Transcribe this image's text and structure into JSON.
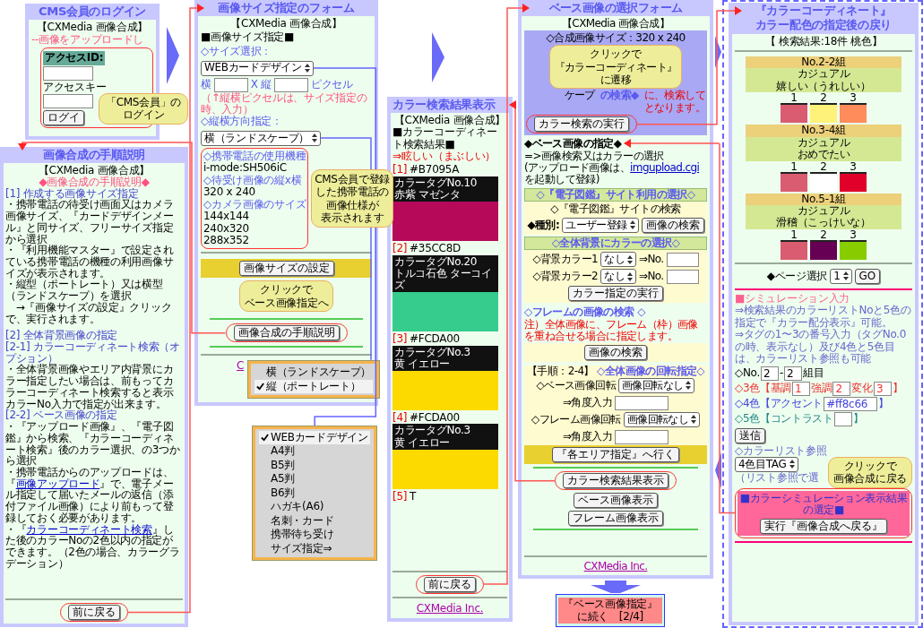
{
  "login_panel": {
    "title": "CMS会員のログイン",
    "header": "【CXMedia 画像合成】",
    "notice": "--画像をアップロードし",
    "id_label": "アクセスID:",
    "key_label": "アクセスキー",
    "login_button": "ログイ"
  },
  "login_callout": [
    "「CMS会員」の",
    "ログイン"
  ],
  "size_form": {
    "title": "画像サイズ指定のフォーム",
    "header": "【CXMedia 画像合成】",
    "section": "■画像サイズ指定■",
    "size_label": "◇サイズ選択：",
    "size_select": "WEBカードデザイン",
    "width_label": "横",
    "height_label": "X 縦",
    "pixel_unit": "ピクセル",
    "pixel_note": "（↑縦横ピクセルは、サイズ指定の時、入力）",
    "orientation_label": "◇縦横方向指定：",
    "orientation_select": "横（ランドスケープ）",
    "specs": [
      {
        "kind": "heading",
        "text": "◇携帯電話の使用機種"
      },
      {
        "kind": "value",
        "text": "i-mode:SH506iC"
      },
      {
        "kind": "heading",
        "text": "◇待受け画像の縦x横"
      },
      {
        "kind": "value",
        "text": "320 x 240"
      },
      {
        "kind": "heading",
        "text": "◇カメラ画像のサイズ"
      },
      {
        "kind": "value",
        "text": "144x144"
      },
      {
        "kind": "value",
        "text": "240x320"
      },
      {
        "kind": "value",
        "text": "288x352"
      }
    ],
    "set_button": "画像サイズの設定",
    "guide_button": "画像合成の手順説明",
    "footer_link": "C"
  },
  "spec_callout": [
    "CMS会員で登録",
    "した携帯電話の",
    "画像仕様が",
    "表示されます"
  ],
  "set_callout": [
    "クリックで",
    "ベース画像指定へ"
  ],
  "orientation_menu": [
    {
      "label": "横（ランドスケープ）",
      "selected": false
    },
    {
      "label": "縦（ポートレート）",
      "selected": true
    }
  ],
  "size_menu": [
    {
      "label": "WEBカードデザイン",
      "selected": true
    },
    {
      "label": "A4判",
      "selected": false
    },
    {
      "label": "B5判",
      "selected": false
    },
    {
      "label": "A5判",
      "selected": false
    },
    {
      "label": "B6判",
      "selected": false
    },
    {
      "label": "ハガキ(A6)",
      "selected": false
    },
    {
      "label": "名刺・カード",
      "selected": false
    },
    {
      "label": "携帯待ち受け",
      "selected": false
    },
    {
      "label": "サイズ指定⇒",
      "selected": false
    }
  ],
  "procedure": {
    "title": "画像合成の手順説明",
    "header": "【CXMedia 画像合成】",
    "subtitle": "◆画像合成の手順説明◆",
    "blocks": [
      {
        "kind": "heading",
        "parts": [
          {
            "kind": "plain",
            "text": "[1] 作成する画像サイズ指定"
          }
        ]
      },
      {
        "kind": "text",
        "parts": [
          {
            "kind": "plain",
            "text": "・携帯電話の待受け画面又はカメラ画像サイズ、『カードデザインメール』と同サイズ、フリーサイズ指定から選択"
          }
        ]
      },
      {
        "kind": "text",
        "parts": [
          {
            "kind": "plain",
            "text": "・『利用機能マスター』で設定されている携帯電話の機種の利用画像サイズが表示されます。"
          }
        ]
      },
      {
        "kind": "text",
        "parts": [
          {
            "kind": "plain",
            "text": "・縦型（ポートレート）又は横型（ランドスケープ）を選択"
          }
        ]
      },
      {
        "kind": "text",
        "parts": [
          {
            "kind": "plain",
            "text": "　→『画像サイズの設定』クリックで、実行されます。"
          }
        ]
      },
      {
        "kind": "gap"
      },
      {
        "kind": "heading",
        "parts": [
          {
            "kind": "plain",
            "text": "[2] 全体背景画像の指定"
          }
        ]
      },
      {
        "kind": "heading",
        "parts": [
          {
            "kind": "plain",
            "text": "[2-1] カラーコーディネート検索（オプション）"
          }
        ]
      },
      {
        "kind": "text",
        "parts": [
          {
            "kind": "plain",
            "text": "・全体背景画像やエリア内背景にカラー指定したい場合は、前もってカラーコーディネート検索すると表示カラーNo入力で指定が出来ます。"
          }
        ]
      },
      {
        "kind": "heading",
        "parts": [
          {
            "kind": "plain",
            "text": "[2-2] ベース画像の指定"
          }
        ]
      },
      {
        "kind": "text",
        "parts": [
          {
            "kind": "plain",
            "text": "・『アップロード画像』、『電子図鑑』から検索、『カラーコーディネート検索』後のカラー選択、の3つから選択"
          }
        ]
      },
      {
        "kind": "text",
        "parts": [
          {
            "kind": "plain",
            "text": "・携帯電話からのアップロードは、『"
          },
          {
            "kind": "link",
            "text": "画像アップロード"
          },
          {
            "kind": "plain",
            "text": "』で、電子メール指定して届いたメールの返信（添付ファイル画像）により前もって登録しておく必要があります。"
          }
        ]
      },
      {
        "kind": "text",
        "parts": [
          {
            "kind": "plain",
            "text": "・『"
          },
          {
            "kind": "link",
            "text": "カラーコーディネート検索"
          },
          {
            "kind": "plain",
            "text": "』した後のカラーNoの2色以内の指定ができます。（2色の場合、カラーグラデーション）"
          }
        ]
      }
    ],
    "back_button": "前に戻る"
  },
  "color_results": {
    "title": "カラー検索結果表示",
    "header": "【CXMedia 画像合成】",
    "subtitle": "■カラーコーディネート検索結果■",
    "mood": "⇒眩しい（まぶしい）",
    "swatches": [
      {
        "index": "[1]",
        "code": "#B7095A",
        "tag": "カラータグNo.10",
        "name": "赤紫 マゼンタ",
        "color": "#b7095a"
      },
      {
        "index": "[2]",
        "code": "#35CC8D",
        "tag": "カラータグNo.20",
        "name": "トルコ石色 ターコイズ",
        "color": "#35cc8d"
      },
      {
        "index": "[3]",
        "code": "#FCDA00",
        "tag": "カラータグNo.3",
        "name": "黄 イエロー",
        "color": "#fcda00"
      },
      {
        "index": "[4]",
        "code": "#FCDA00",
        "tag": "カラータグNo.3",
        "name": "黄 イエロー",
        "color": "#fcda00"
      }
    ],
    "last_index": "[5]",
    "last_code": "T",
    "back_button": "前に戻る",
    "footer_link": "CXMedia Inc."
  },
  "base_form": {
    "title": "ベース画像の選択フォーム",
    "header": "【CXMedia 画像合成】",
    "size_line": "◇合成画像サイズ：320 x 240",
    "fragments": [
      {
        "kind": "plain",
        "text": "ケープ"
      },
      {
        "kind": "heading",
        "text": "の検索◆"
      },
      {
        "kind": "note",
        "text": "に、検索して"
      },
      {
        "kind": "note",
        "text": "となります。"
      }
    ],
    "color_search_button": "カラー検索の実行",
    "base_heading": "◆ベース画像の指定◆",
    "base_line": "=>画像検索又はカラーの選択",
    "upload_before": "(アップロード画像は、",
    "upload_link": "imgupload.cgi",
    "upload_after": "を起動して登録)",
    "zukan_heading": "◇『電子図鑑』サイト利用の選択◇",
    "zukan_line": "◇『電子図鑑』サイトの検索",
    "kind_label": "◆種別:",
    "kind_select": "ユーザー登録",
    "image_search_button": "画像の検索",
    "bg_heading": "◇全体背景にカラーの選択◇",
    "bg_rows": [
      {
        "label": "◇背景カラー1",
        "select": "なし",
        "no_label": "⇒No."
      },
      {
        "label": "◇背景カラー2",
        "select": "なし",
        "no_label": "⇒No."
      }
    ],
    "bg_button": "カラー指定の実行",
    "frame_heading": "◇フレームの画像の検索 ◇",
    "frame_note": "注）全体画像に、フレーム（枠）画像を重ね合せる場合に指定します。",
    "frame_button": "画像の検索",
    "rotate_step": "【手順：2-4】",
    "rotate_heading": "◇全体画像の回転指定◇",
    "rotate_rows": [
      {
        "label": "◇ベース画像回転",
        "select": "画像回転なし",
        "angle_label": "⇒角度入力"
      },
      {
        "label": "◇フレーム画像回転",
        "select": "画像回転なし",
        "angle_label": "⇒角度入力"
      }
    ],
    "area_button": "『各エリア指定』へ行く",
    "buttons": [
      "カラー検索結果表示",
      "ベース画像表示",
      "フレーム画像表示"
    ],
    "footer_link": "CXMedia Inc."
  },
  "base_callout": [
    "クリックで",
    "『カラーコーディネート』",
    "に遷移"
  ],
  "continue_box": [
    "『ベース画像指定』",
    "に続く　[2/4]"
  ],
  "coordinate": {
    "title": [
      "『カラーコーディネート』",
      "カラー配色の指定後の戻り"
    ],
    "result": "【 検索結果:18件 桃色】",
    "groups": [
      {
        "name": "No.2-2組",
        "style": "カジュアル",
        "mood": "嬉しい（うれしい）",
        "swatches": [
          {
            "number": "1",
            "color": "#d95c70"
          },
          {
            "number": "2",
            "color": "#fff27a"
          },
          {
            "number": "3",
            "color": "#ff8c5a"
          }
        ]
      },
      {
        "name": "No.3-4組",
        "style": "カジュアル",
        "mood": "おめでたい",
        "swatches": [
          {
            "number": "1",
            "color": "#d95c70"
          },
          {
            "number": "2",
            "color": "#ffffff"
          },
          {
            "number": "3",
            "color": "#e0002a"
          }
        ]
      },
      {
        "name": "No.5-1組",
        "style": "カジュアル",
        "mood": "滑稽（こっけいな）",
        "swatches": [
          {
            "number": "1",
            "color": "#d95c70"
          },
          {
            "number": "2",
            "color": "#660055"
          },
          {
            "number": "3",
            "color": "#88cc00"
          }
        ]
      }
    ],
    "page_label": "◆ページ選択",
    "page_select": "1",
    "go_button": "GO",
    "sim_heading": "■シミュレーション入力",
    "sim_notes": [
      "⇒検索結果のカラーリストNoと5色の指定で『カラー配分表示』可能。",
      "⇒タグの1〜3の番号入力（タグNo.0の時、表示なし）及び4色と5色目は、カラーリスト参照も可能"
    ],
    "sim_rows": [
      {
        "kind": "plain",
        "parts": [
          {
            "kind": "label",
            "text": "◇No."
          },
          {
            "kind": "input",
            "value": "2"
          },
          {
            "kind": "label",
            "text": "-"
          },
          {
            "kind": "input",
            "value": "2"
          },
          {
            "kind": "label",
            "text": "組目"
          }
        ]
      },
      {
        "kind": "red",
        "parts": [
          {
            "kind": "label",
            "text": "◇3色【基調"
          },
          {
            "kind": "input",
            "value": "1"
          },
          {
            "kind": "label",
            "text": "強調"
          },
          {
            "kind": "input",
            "value": "2"
          },
          {
            "kind": "label",
            "text": "変化"
          },
          {
            "kind": "input",
            "value": "3"
          },
          {
            "kind": "label",
            "text": "】"
          }
        ]
      },
      {
        "kind": "blue",
        "parts": [
          {
            "kind": "label",
            "text": "◇4色【アクセント"
          },
          {
            "kind": "input",
            "value": "#ff8c66"
          },
          {
            "kind": "label",
            "text": "】"
          }
        ]
      },
      {
        "kind": "teal",
        "parts": [
          {
            "kind": "label",
            "text": "◇5色【コントラスト"
          },
          {
            "kind": "input"
          },
          {
            "kind": "label",
            "text": "】"
          }
        ]
      }
    ],
    "send_button": "送信",
    "list_label": "◇カラーリスト参照",
    "list_select": "4色目TAG",
    "list_note": "（リスト参照で選",
    "pink_heading": "■カラーシミュレーション表示結果の選定■",
    "return_button": "実行『画像合成へ戻る』"
  },
  "return_callout": [
    "クリックで",
    "画像合成に戻る"
  ]
}
